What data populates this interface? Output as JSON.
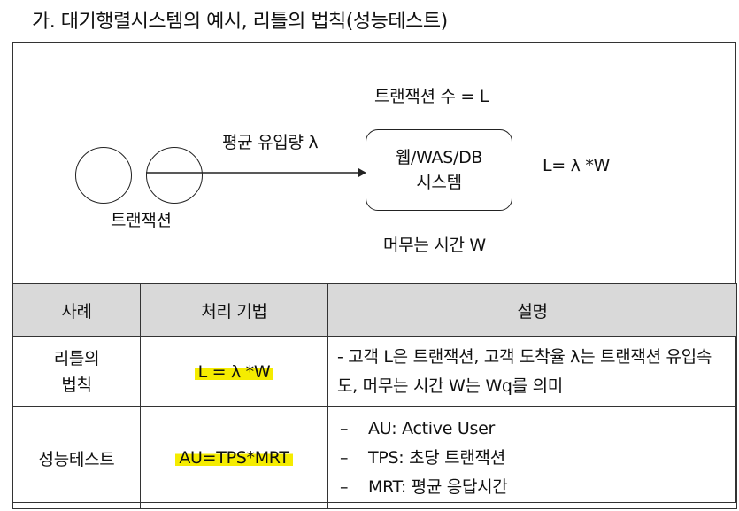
{
  "heading": "가. 대기행렬시스템의 예시, 리틀의 법칙(성능테스트)",
  "diagram": {
    "customer_label": "트랜잭션",
    "arrow_label": "평균 유입량 λ",
    "system_line1": "웹/WAS/DB",
    "system_line2": "시스템",
    "transactions_label": "트랜잭션 수 = L",
    "wait_label": "머무는 시간 W",
    "formula": "L= λ *W"
  },
  "table": {
    "headers": [
      "사례",
      "처리 기법",
      "설명"
    ],
    "rows": [
      {
        "case_line1": "리틀의",
        "case_line2": "법칙",
        "method": "L = λ *W",
        "description": "- 고객 L은 트랜잭션, 고객 도착율 λ는 트랜잭션 유입속도, 머무는 시간 W는 Wq를 의미"
      },
      {
        "case": "성능테스트",
        "method": "AU=TPS*MRT",
        "bullets": [
          {
            "dash": "–",
            "text": "AU: Active User"
          },
          {
            "dash": "–",
            "text": "TPS: 초당 트랜잭션"
          },
          {
            "dash": "–",
            "text": "MRT: 평균 응답시간"
          }
        ]
      }
    ]
  },
  "highlight_color": "#f5ec00"
}
